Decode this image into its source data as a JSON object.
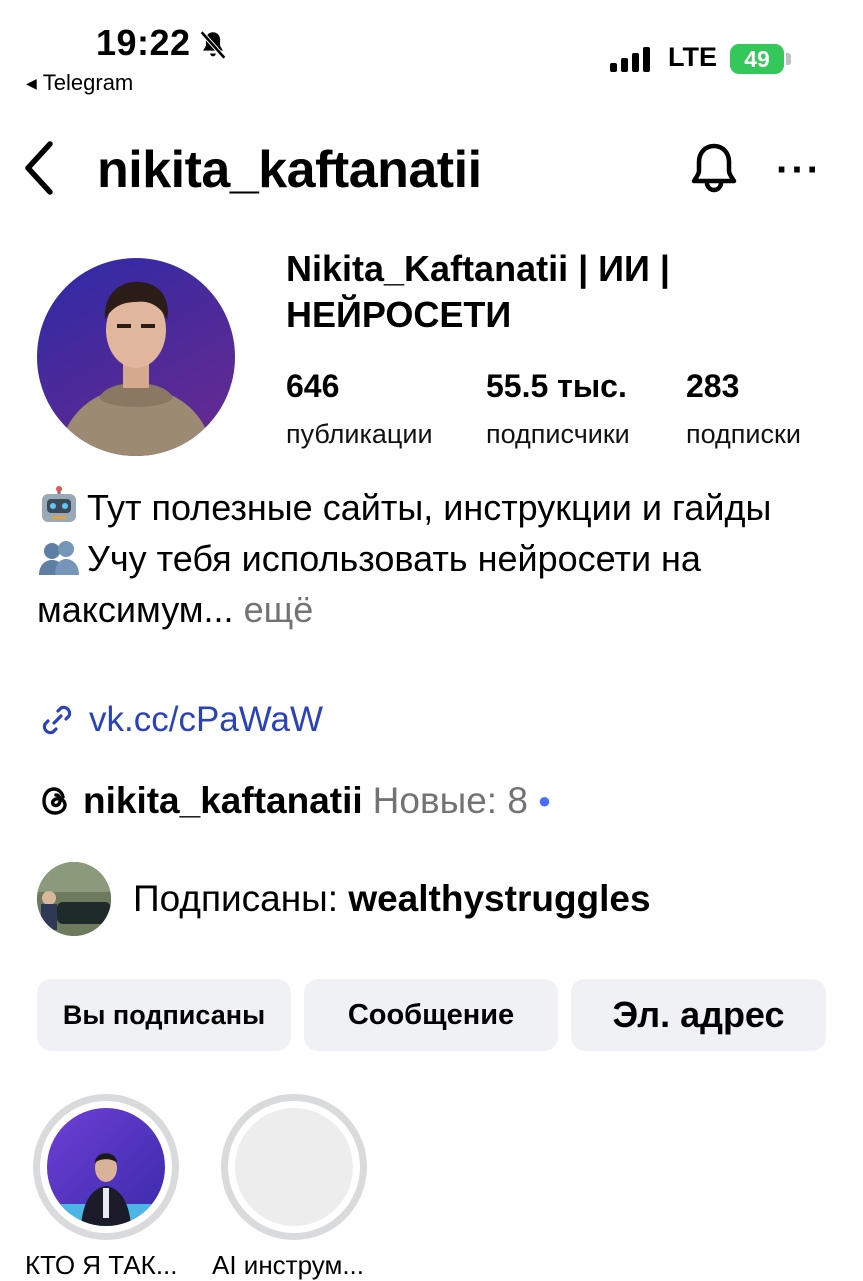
{
  "status_bar": {
    "time": "19:22",
    "back_app": "Telegram",
    "network": "LTE",
    "battery": "49"
  },
  "header": {
    "username": "nikita_kaftanatii",
    "icons": [
      "chevron-left-icon",
      "bell-icon",
      "more-icon"
    ],
    "more_label": "···"
  },
  "profile": {
    "display_name_line1": "Nikita_Kaftanatii | ИИ |",
    "display_name_line2": "НЕЙРОСЕТИ",
    "stats": [
      {
        "value": "646",
        "label": "публикации"
      },
      {
        "value": "55.5 тыс.",
        "label": "подписчики"
      },
      {
        "value": "283",
        "label": "подписки"
      }
    ]
  },
  "bio": {
    "line1": "Тут полезные сайты, инструкции и гайды",
    "line2": "Учу тебя использовать нейросети на максимум...",
    "more": "ещё",
    "link": "vk.cc/cPaWaW"
  },
  "threads": {
    "name": "nikita_kaftanatii",
    "new": "Новые: 8"
  },
  "followed_by": {
    "prefix": "Подписаны: ",
    "who": "wealthystruggles"
  },
  "buttons": {
    "following": "Вы подписаны",
    "message": "Сообщение",
    "email": "Эл. адрес"
  },
  "highlights": [
    {
      "label": "КТО Я ТАК..."
    },
    {
      "label": "AI инструм..."
    }
  ],
  "colors": {
    "link": "#2a43b8",
    "button_bg": "#eff1f4",
    "battery": "#34c759",
    "muted_text": "#737373"
  }
}
